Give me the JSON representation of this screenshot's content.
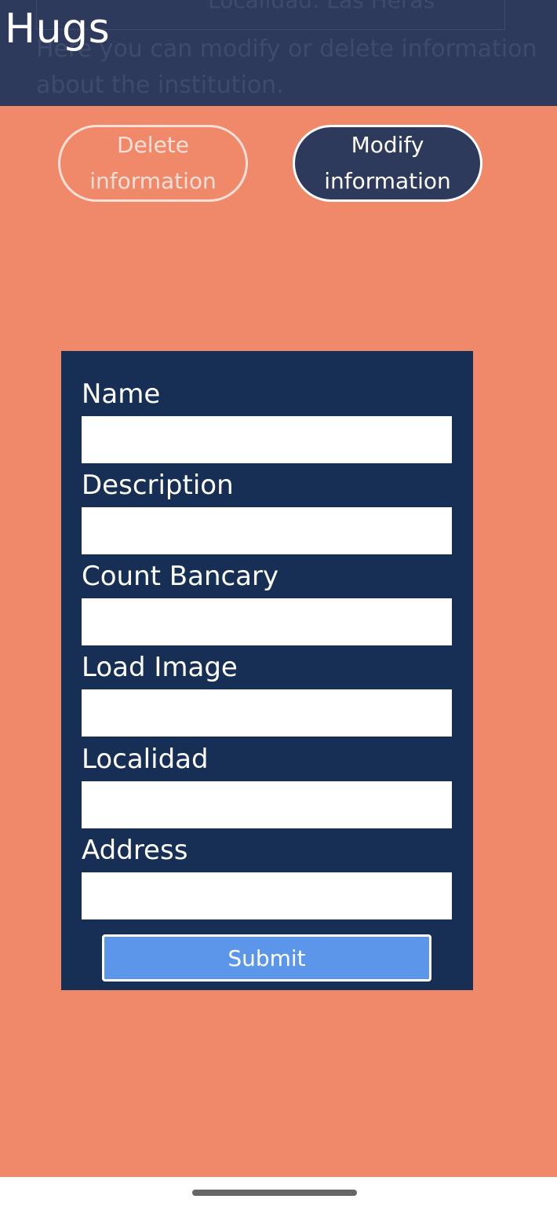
{
  "header": {
    "brand": "Hugs",
    "ghost_locality": "Localidad: Las Heras",
    "ghost_description": "Here you can modify or delete information about the institution."
  },
  "actions": {
    "delete_label": "Delete information",
    "modify_label": "Modify information"
  },
  "form": {
    "fields": [
      {
        "label": "Name",
        "value": ""
      },
      {
        "label": "Description",
        "value": ""
      },
      {
        "label": "Count Bancary",
        "value": ""
      },
      {
        "label": "Load Image",
        "value": ""
      },
      {
        "label": "Localidad",
        "value": ""
      },
      {
        "label": "Address",
        "value": ""
      }
    ],
    "submit_label": "Submit"
  },
  "colors": {
    "background": "#f0886a",
    "header": "#2d3a5b",
    "form_panel": "#172f55",
    "submit": "#5b96ea"
  }
}
